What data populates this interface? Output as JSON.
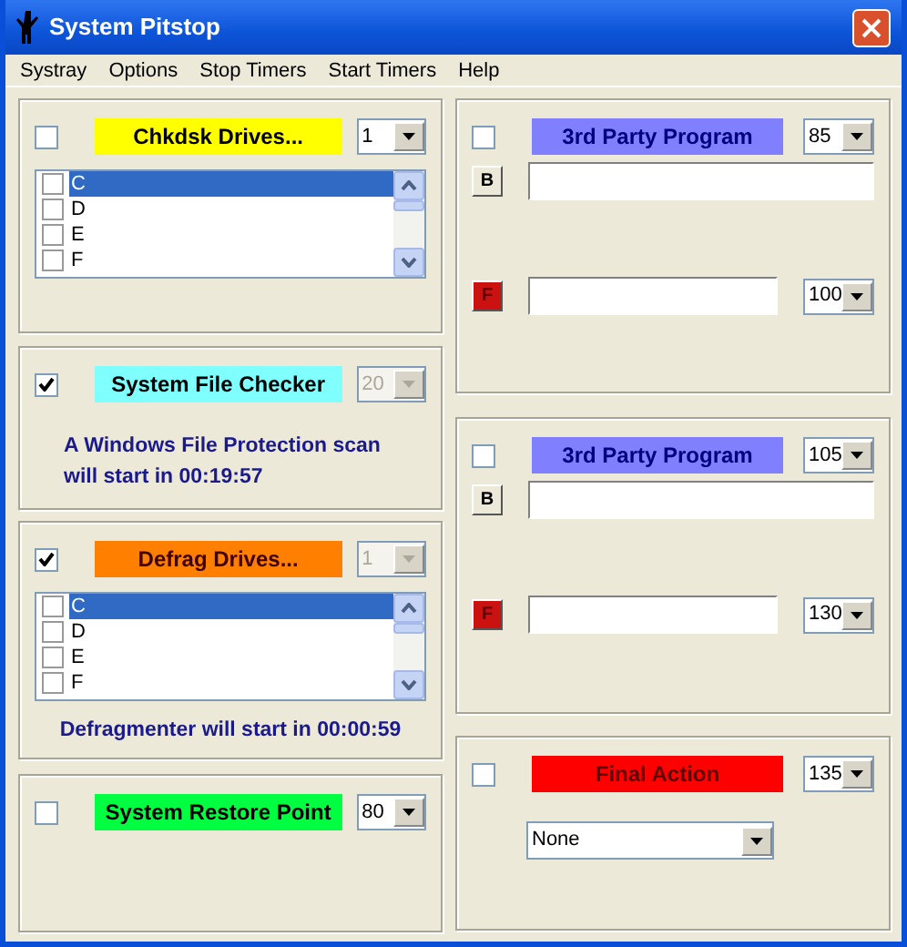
{
  "window": {
    "title": "System Pitstop"
  },
  "menu": [
    "Systray",
    "Options",
    "Stop Timers",
    "Start Timers",
    "Help"
  ],
  "left_panels": [
    {
      "kind": "drives",
      "checked": false,
      "title": "Chkdsk Drives...",
      "color": "#ffff00",
      "interval": {
        "value": "1",
        "disabled": false
      },
      "drives": [
        {
          "label": "C",
          "checked": false,
          "selected": true
        },
        {
          "label": "D",
          "checked": false,
          "selected": false
        },
        {
          "label": "E",
          "checked": false,
          "selected": false
        },
        {
          "label": "F",
          "checked": false,
          "selected": false
        }
      ]
    },
    {
      "kind": "info",
      "checked": true,
      "title": "System File Checker",
      "color": "#80ffff",
      "interval": {
        "value": "20",
        "disabled": true
      },
      "message": "A Windows File Protection scan will start in 00:19:57"
    },
    {
      "kind": "drives",
      "checked": true,
      "title": "Defrag Drives...",
      "color": "#ff8000",
      "interval": {
        "value": "1",
        "disabled": true
      },
      "drives": [
        {
          "label": "C",
          "checked": false,
          "selected": true
        },
        {
          "label": "D",
          "checked": false,
          "selected": false
        },
        {
          "label": "E",
          "checked": false,
          "selected": false
        },
        {
          "label": "F",
          "checked": false,
          "selected": false
        }
      ],
      "message": "Defragmenter will start in 00:00:59"
    },
    {
      "kind": "plain",
      "checked": false,
      "title": "System Restore Point",
      "color": "#00ff40",
      "interval": {
        "value": "80",
        "disabled": false
      }
    }
  ],
  "right_panels": [
    {
      "kind": "program",
      "checked": false,
      "title": "3rd Party Program",
      "color": "#8080ff",
      "interval": {
        "value": "85",
        "disabled": false
      },
      "browse_button": "B",
      "file_button": "F",
      "file_interval": {
        "value": "100",
        "disabled": false
      }
    },
    {
      "kind": "program",
      "checked": false,
      "title": "3rd Party Program",
      "color": "#8080ff",
      "interval": {
        "value": "105",
        "disabled": false
      },
      "browse_button": "B",
      "file_button": "F",
      "file_interval": {
        "value": "130",
        "disabled": false
      }
    },
    {
      "kind": "final",
      "checked": false,
      "title": "Final Action",
      "color": "#ff0000",
      "interval": {
        "value": "135",
        "disabled": false
      },
      "action": "None"
    }
  ]
}
